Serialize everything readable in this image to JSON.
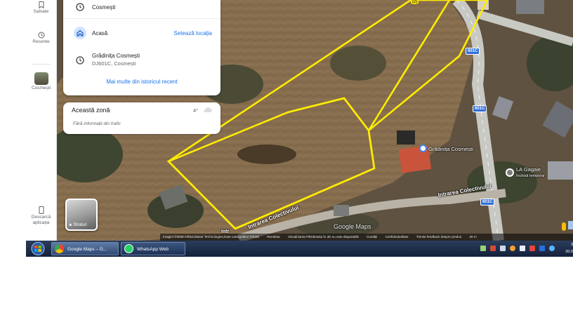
{
  "rail": {
    "saved": "Salvate",
    "recent": "Recente",
    "place": "Cosmești",
    "download": "Descarcă aplicația"
  },
  "recent_card": {
    "item1": "Cosmești",
    "home_label": "Acasă",
    "home_action": "Setează locația",
    "item3_title": "Grădinița Cosmești",
    "item3_sub": "DJ601C, Cosmești",
    "more": "Mai multe din istoricul recent"
  },
  "zone_card": {
    "title": "Această zonă",
    "temp": "4°",
    "traffic": "Fără informații din trafic"
  },
  "layers": {
    "label": "Straturi"
  },
  "map_labels": {
    "pin_number": "(2)",
    "road_badge": "601C",
    "poi_school": "Grădinița Cosmești",
    "poi_shop_name": "LA Gagaie",
    "poi_shop_status": "Închisă temporar",
    "street1": "Intrarea Colectivului",
    "street2": "Intrarea Colectivului",
    "watermark": "Google Maps",
    "partial_street": "Intr"
  },
  "attribution": {
    "imagery": "Imagini ©2026 Airbus,Maxar Technologies,Date cartografice ©2026",
    "romania": "România",
    "view3d": "Vizualizarea Pământului în 3D nu este disponibilă",
    "terms": "Condiții",
    "privacy": "Confidențialitate",
    "feedback": "Trimite feedback despre produs",
    "scale": "20 m"
  },
  "taskbar": {
    "chrome_label": "Google Maps – G...",
    "whatsapp_label": "WhatsApp Web",
    "clock_time": "3",
    "clock_date": "30.0"
  },
  "colors": {
    "plot_outline": "#ffec00",
    "link_blue": "#1a73e8",
    "badge_blue": "#2f6fd8"
  }
}
